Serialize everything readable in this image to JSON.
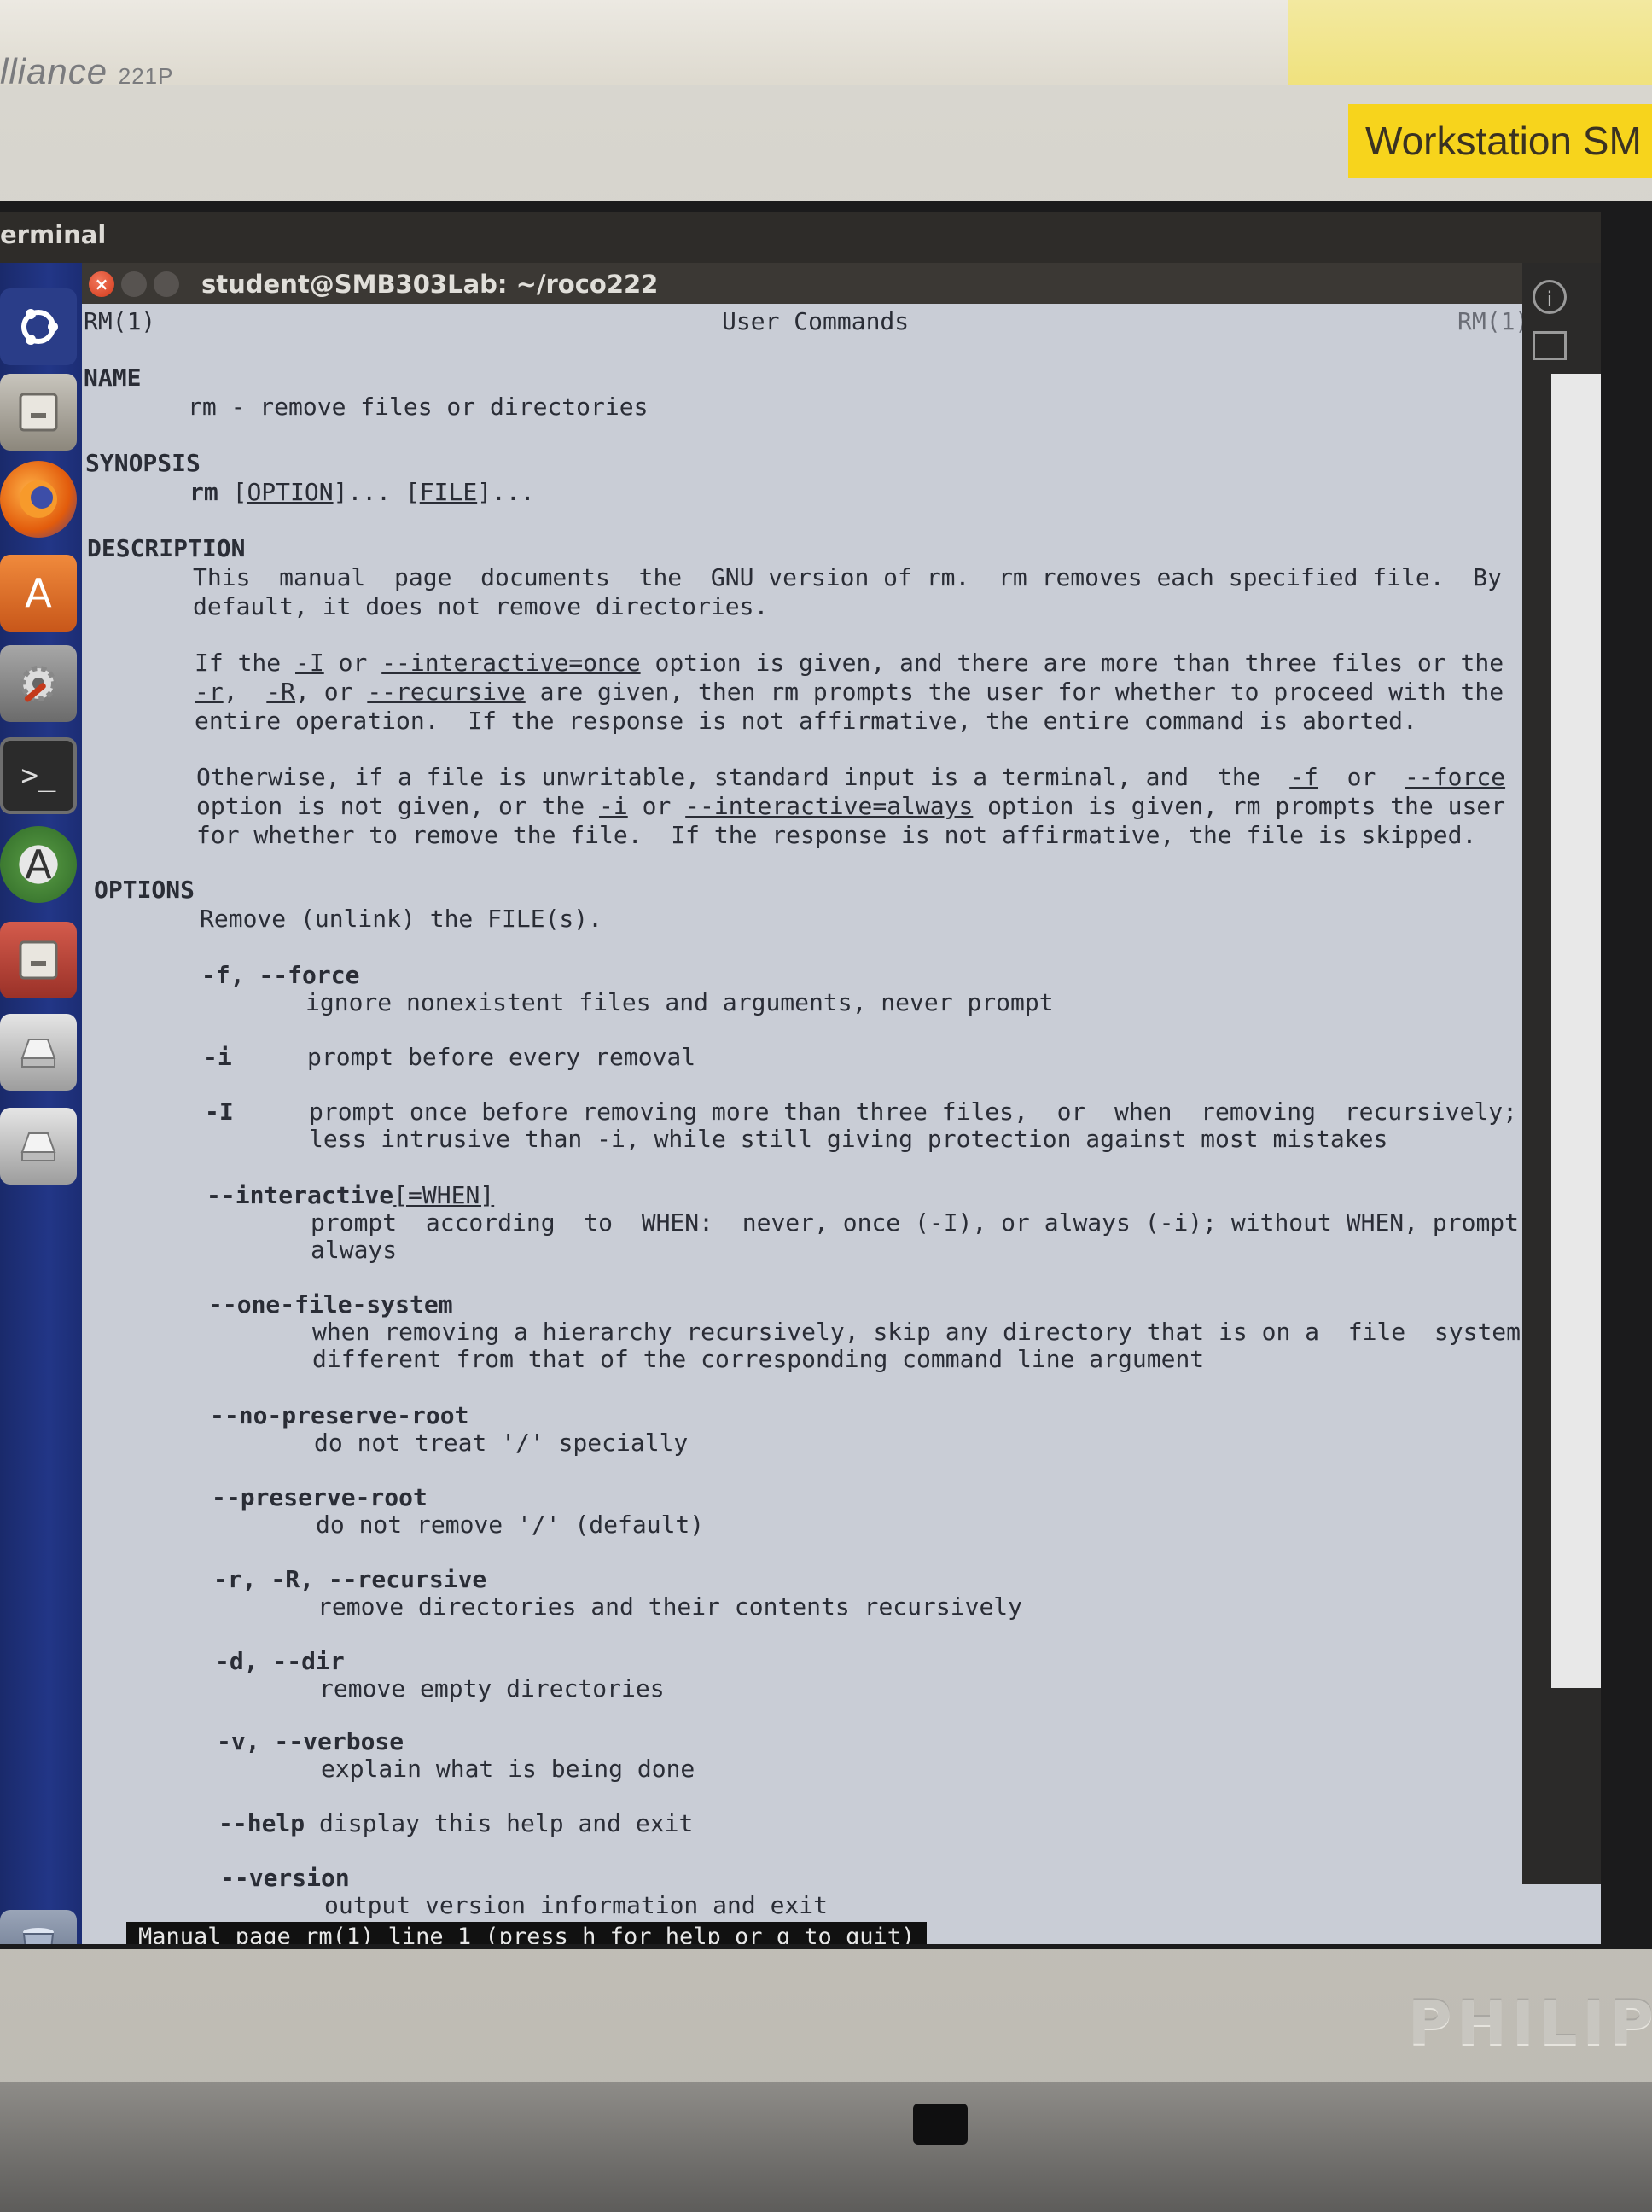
{
  "environment": {
    "brand_label": "lliance",
    "brand_model": "221P",
    "asset_label": "Workstation SM",
    "monitor_logo": "PHILIPS"
  },
  "topbar": {
    "title": "erminal"
  },
  "launcher": {
    "items": [
      {
        "name": "dash",
        "icon": "ubuntu-logo"
      },
      {
        "name": "files",
        "icon": "file-cabinet"
      },
      {
        "name": "firefox",
        "icon": "firefox"
      },
      {
        "name": "software-center",
        "icon": "shopping-bag-A"
      },
      {
        "name": "system-settings",
        "icon": "gear-wrench"
      },
      {
        "name": "terminal",
        "icon": "terminal-prompt"
      },
      {
        "name": "software-updater",
        "icon": "updates-A"
      },
      {
        "name": "files-2",
        "icon": "file-cabinet"
      },
      {
        "name": "drive-1",
        "icon": "hard-drive"
      },
      {
        "name": "drive-2",
        "icon": "hard-drive"
      },
      {
        "name": "trash",
        "icon": "trash-can"
      }
    ]
  },
  "window": {
    "title": "student@SMB303Lab: ~/roco222"
  },
  "man": {
    "header_left": "RM(1)",
    "header_center": "User Commands",
    "header_right": "RM(1)",
    "name_heading": "NAME",
    "name_text": "rm - remove files or directories",
    "synopsis_heading": "SYNOPSIS",
    "synopsis_cmd": "rm",
    "synopsis_option": "OPTION",
    "synopsis_file": "FILE",
    "description_heading": "DESCRIPTION",
    "desc_p1_l1": "This  manual  page  documents  the  GNU version of rm.  rm removes each specified file.  By",
    "desc_p1_l2": "default, it does not remove directories.",
    "desc_p2_l1_a": "If the ",
    "desc_p2_l1_I": "-I",
    "desc_p2_l1_b": " or ",
    "desc_p2_l1_once": "--interactive=once",
    "desc_p2_l1_c": " option is given, and there are more than three files or the",
    "desc_p2_l2_r": "-r",
    "desc_p2_l2_a": ",  ",
    "desc_p2_l2_R": "-R",
    "desc_p2_l2_b": ", or ",
    "desc_p2_l2_rec": "--recursive",
    "desc_p2_l2_c": " are given, then rm prompts the user for whether to proceed with the",
    "desc_p2_l3": "entire operation.  If the response is not affirmative, the entire command is aborted.",
    "desc_p3_l1_a": "Otherwise, if a file is unwritable, standard input is a terminal, and  the  ",
    "desc_p3_l1_f": "-f",
    "desc_p3_l1_b": "  or  ",
    "desc_p3_l1_force": "--force",
    "desc_p3_l2_a": "option is not given, or the ",
    "desc_p3_l2_i": "-i",
    "desc_p3_l2_b": " or ",
    "desc_p3_l2_always": "--interactive=always",
    "desc_p3_l2_c": " option is given, rm prompts the user",
    "desc_p3_l3": "for whether to remove the file.  If the response is not affirmative, the file is skipped.",
    "options_heading": "OPTIONS",
    "options_intro": "Remove (unlink) the FILE(s).",
    "opt_f_flag": "-f, --force",
    "opt_f_desc": "ignore nonexistent files and arguments, never prompt",
    "opt_i_flag": "-i",
    "opt_i_desc": "prompt before every removal",
    "opt_I_flag": "-I",
    "opt_I_desc1": "prompt once before removing more than three files,  or  when  removing  recursively;",
    "opt_I_desc2": "less intrusive than -i, while still giving protection against most mistakes",
    "opt_interactive_flag": "--interactive",
    "opt_interactive_when": "[=WHEN]",
    "opt_interactive_desc1": "prompt  according  to  WHEN:  never, once (-I), or always (-i); without WHEN, prompt",
    "opt_interactive_desc2": "always",
    "opt_ofs_flag": "--one-file-system",
    "opt_ofs_desc1": "when removing a hierarchy recursively, skip any directory that is on a  file  system",
    "opt_ofs_desc2": "different from that of the corresponding command line argument",
    "opt_npr_flag": "--no-preserve-root",
    "opt_npr_desc": "do not treat '/' specially",
    "opt_pr_flag": "--preserve-root",
    "opt_pr_desc": "do not remove '/' (default)",
    "opt_r_flag": "-r, -R, --recursive",
    "opt_r_desc": "remove directories and their contents recursively",
    "opt_d_flag": "-d, --dir",
    "opt_d_desc": "remove empty directories",
    "opt_v_flag": "-v, --verbose",
    "opt_v_desc": "explain what is being done",
    "opt_help_flag": "--help",
    "opt_help_desc": "display this help and exit",
    "opt_version_flag": "--version",
    "opt_version_desc": "output version information and exit"
  },
  "status_line": "Manual page rm(1) line 1 (press h for help or q to quit)"
}
